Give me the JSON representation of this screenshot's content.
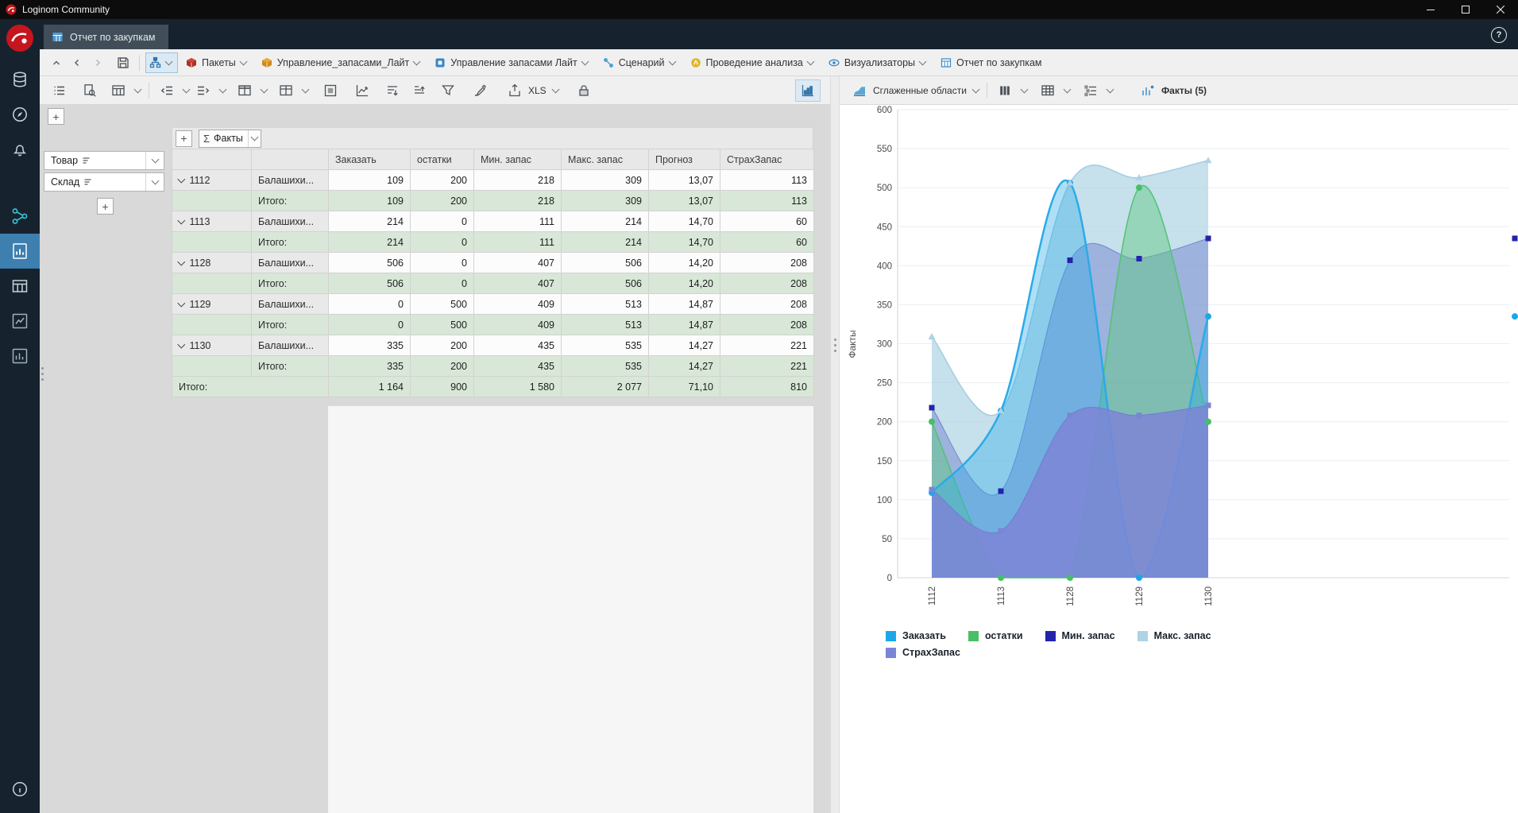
{
  "titlebar": {
    "title": "Loginom Community"
  },
  "tabbar": {
    "tabs": [
      {
        "label": "Отчет по закупкам"
      }
    ],
    "help": "?"
  },
  "breadcrumb": {
    "items": [
      {
        "label": "Пакеты",
        "icon": "packages",
        "dropdown": true
      },
      {
        "label": "Управление_запасами_Лайт",
        "icon": "package",
        "dropdown": true
      },
      {
        "label": "Управление запасами Лайт",
        "icon": "module",
        "dropdown": true
      },
      {
        "label": "Сценарий",
        "icon": "scenario",
        "dropdown": true
      },
      {
        "label": "Проведение анализа",
        "icon": "analysis",
        "dropdown": true
      },
      {
        "label": "Визуализаторы",
        "icon": "visualizers",
        "dropdown": true
      },
      {
        "label": "Отчет по закупкам",
        "icon": "report",
        "dropdown": false
      }
    ]
  },
  "left_toolbar": {
    "xls_label": "XLS"
  },
  "dims": {
    "add_column": "+",
    "add_row": "+",
    "fields": [
      {
        "label": "Товар"
      },
      {
        "label": "Склад"
      }
    ]
  },
  "pivot": {
    "add": "+",
    "sigma": "Σ",
    "facts_label": "Факты",
    "columns": [
      "Заказать",
      "остатки",
      "Мин. запас",
      "Макс. запас",
      "Прогноз",
      "СтрахЗапас"
    ],
    "row_total_label": "Итого:",
    "groups": [
      {
        "id": "1112",
        "sub": "Балашихи...",
        "values": [
          "109",
          "200",
          "218",
          "309",
          "13,07",
          "113"
        ],
        "total": [
          "109",
          "200",
          "218",
          "309",
          "13,07",
          "113"
        ]
      },
      {
        "id": "1113",
        "sub": "Балашихи...",
        "values": [
          "214",
          "0",
          "111",
          "214",
          "14,70",
          "60"
        ],
        "total": [
          "214",
          "0",
          "111",
          "214",
          "14,70",
          "60"
        ]
      },
      {
        "id": "1128",
        "sub": "Балашихи...",
        "values": [
          "506",
          "0",
          "407",
          "506",
          "14,20",
          "208"
        ],
        "total": [
          "506",
          "0",
          "407",
          "506",
          "14,20",
          "208"
        ]
      },
      {
        "id": "1129",
        "sub": "Балашихи...",
        "values": [
          "0",
          "500",
          "409",
          "513",
          "14,87",
          "208"
        ],
        "total": [
          "0",
          "500",
          "409",
          "513",
          "14,87",
          "208"
        ]
      },
      {
        "id": "1130",
        "sub": "Балашихи...",
        "values": [
          "335",
          "200",
          "435",
          "535",
          "14,27",
          "221"
        ],
        "total": [
          "335",
          "200",
          "435",
          "535",
          "14,27",
          "221"
        ]
      }
    ],
    "grand_total": {
      "label": "Итого:",
      "values": [
        "1 164",
        "900",
        "1 580",
        "2 077",
        "71,10",
        "810"
      ]
    }
  },
  "right_toolbar": {
    "chart_type_label": "Сглаженные области",
    "facts_label": "Факты (5)"
  },
  "chart_data": {
    "type": "area",
    "smoothed": true,
    "title": "",
    "xlabel": "",
    "ylabel": "Факты",
    "ylim": [
      0,
      600
    ],
    "ytick_step": 50,
    "grid": true,
    "legend_position": "bottom",
    "categories": [
      "1112",
      "1113",
      "1128",
      "1129",
      "1130"
    ],
    "series": [
      {
        "name": "Заказать",
        "values": [
          109,
          214,
          506,
          0,
          335
        ],
        "color": "#1ea7e8",
        "fill": "rgba(42,171,232,0.38)",
        "stroke": "#2aabe8",
        "stroke_width": 2.5,
        "marker": "circle"
      },
      {
        "name": "остатки",
        "values": [
          200,
          0,
          0,
          500,
          200
        ],
        "color": "#47c065",
        "fill": "rgba(92,200,125,0.45)",
        "stroke": "#52c274",
        "stroke_width": 1.5,
        "marker": "circle"
      },
      {
        "name": "Мин. запас",
        "values": [
          218,
          111,
          407,
          409,
          435
        ],
        "color": "#2323ab",
        "fill": "rgba(62,72,186,0.30)",
        "stroke": "rgba(62,72,186,0.5)",
        "stroke_width": 1,
        "marker": "square"
      },
      {
        "name": "Макс. запас",
        "values": [
          309,
          214,
          506,
          513,
          535
        ],
        "color": "#aed3e4",
        "fill": "rgba(176,212,228,0.72)",
        "stroke": "#a3cde1",
        "stroke_width": 1.5,
        "marker": "triangle"
      },
      {
        "name": "СтрахЗапас",
        "values": [
          113,
          60,
          208,
          208,
          221
        ],
        "color": "#7a85d6",
        "fill": "rgba(124,133,214,0.85)",
        "stroke": "rgba(112,122,208,0.95)",
        "stroke_width": 1,
        "marker": "square"
      }
    ],
    "draw_order": [
      "Макс. запас",
      "Мин. запас",
      "остатки",
      "Заказать",
      "СтрахЗапас"
    ],
    "edge_markers": [
      {
        "series": "Мин. запас",
        "value": 435
      },
      {
        "series": "Заказать",
        "value": 335
      }
    ]
  }
}
